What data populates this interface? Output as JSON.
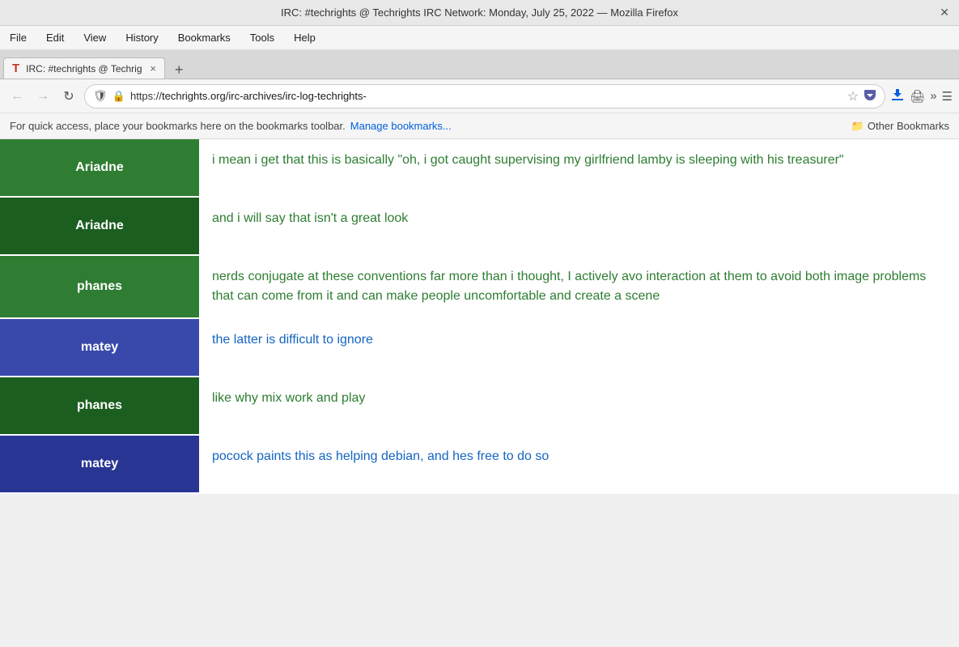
{
  "titleBar": {
    "title": "IRC: #techrights @ Techrights IRC Network: Monday, July 25, 2022 — Mozilla Firefox",
    "closeLabel": "✕"
  },
  "menuBar": {
    "items": [
      "File",
      "Edit",
      "View",
      "History",
      "Bookmarks",
      "Tools",
      "Help"
    ]
  },
  "tab": {
    "icon": "T",
    "title": "IRC: #techrights @ Techrig",
    "closeLabel": "×",
    "newLabel": "+"
  },
  "addressBar": {
    "backLabel": "←",
    "forwardLabel": "→",
    "refreshLabel": "↻",
    "shieldLabel": "🛡",
    "lockLabel": "🔒",
    "urlPrefix": "https://",
    "urlDomain": "techrights.org",
    "urlPath": "/irc-archives/irc-log-techrights-",
    "starLabel": "☆",
    "pocketLabel": "❯",
    "downloadLabel": "⬇",
    "printLabel": "🖨",
    "moreLabel": "»",
    "hamburgerLabel": "☰"
  },
  "bookmarksBar": {
    "text": "For quick access, place your bookmarks here on the bookmarks toolbar.",
    "manageLinkText": "Manage bookmarks...",
    "otherBookmarksIcon": "📁",
    "otherBookmarksLabel": "Other Bookmarks"
  },
  "chat": {
    "rows": [
      {
        "nick": "Ariadne",
        "nickColor": "green",
        "message": "i mean i get that this is basically \"oh, i got caught supervising my girlfriend lamby is sleeping with his treasurer\"",
        "messageColor": "green"
      },
      {
        "nick": "Ariadne",
        "nickColor": "dark-green",
        "message": "and i will say that isn't a great look",
        "messageColor": "green"
      },
      {
        "nick": "phanes",
        "nickColor": "green",
        "message": "nerds conjugate at these conventions far more than i thought, I actively avo interaction at them to avoid both image problems that can come from it and can make people uncomfortable and create a scene",
        "messageColor": "green"
      },
      {
        "nick": "matey",
        "nickColor": "purple",
        "message": "the latter is difficult to ignore",
        "messageColor": "blue"
      },
      {
        "nick": "phanes",
        "nickColor": "dark-green",
        "message": "like why mix work and play",
        "messageColor": "green"
      },
      {
        "nick": "matey",
        "nickColor": "dark-purple",
        "message": "pocock paints this as helping debian, and hes free to do so",
        "messageColor": "blue"
      }
    ]
  }
}
